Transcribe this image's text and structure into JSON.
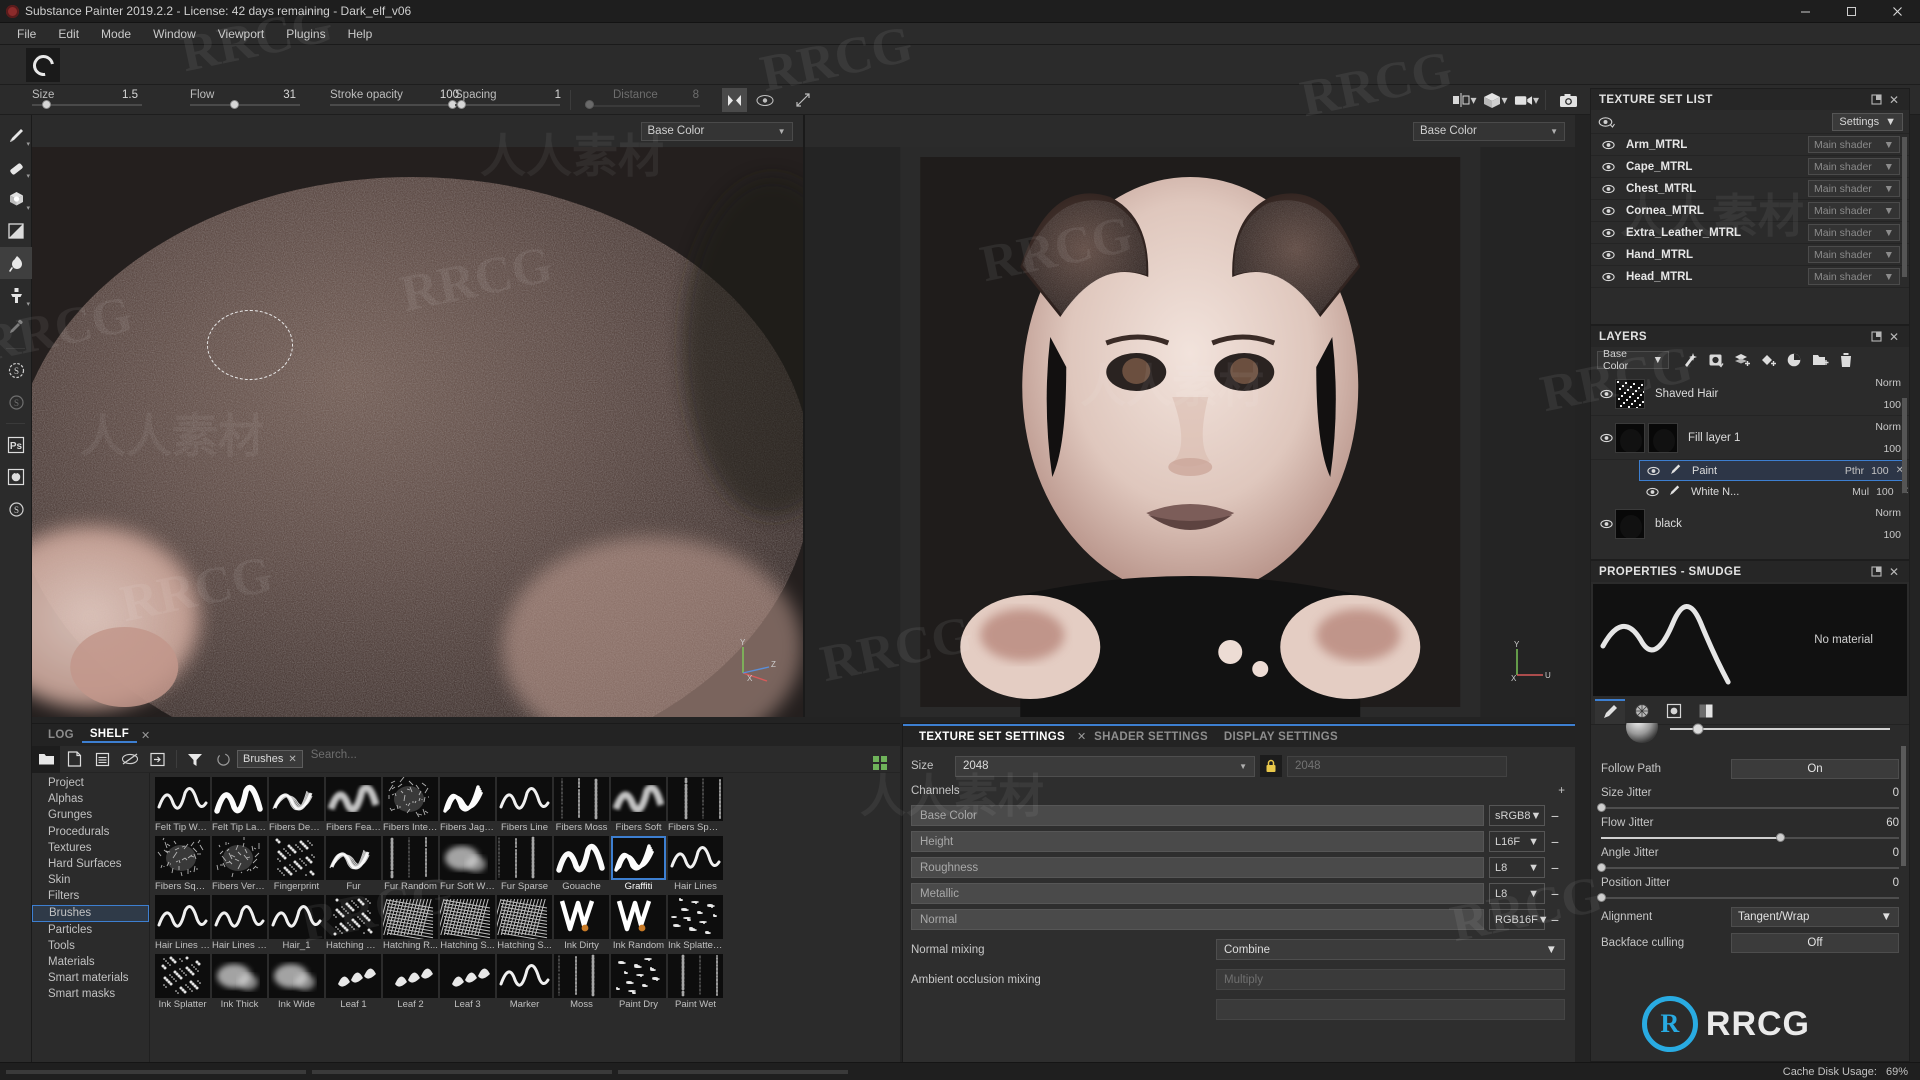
{
  "window": {
    "title": "Substance Painter 2019.2.2 - License: 42 days remaining - Dark_elf_v06",
    "minimize": "─",
    "maximize": "❐",
    "close": "✕"
  },
  "menubar": {
    "items": [
      "File",
      "Edit",
      "Mode",
      "Window",
      "Viewport",
      "Plugins",
      "Help"
    ]
  },
  "brush_params": [
    {
      "label": "Size",
      "value": "1.5",
      "dim": false
    },
    {
      "label": "Flow",
      "value": "31",
      "dim": false
    },
    {
      "label": "Stroke opacity",
      "value": "100",
      "dim": false
    },
    {
      "label": "Spacing",
      "value": "1",
      "dim": false
    },
    {
      "label": "Distance",
      "value": "8",
      "dim": true
    }
  ],
  "viewport": {
    "left_channel": "Base Color",
    "right_channel": "Base Color",
    "axis_labels": [
      "Y",
      "X",
      "Z",
      "Y",
      "X",
      "U"
    ]
  },
  "texture_set_list": {
    "title": "TEXTURE SET LIST",
    "settings_label": "Settings",
    "items": [
      {
        "name": "Arm_MTRL",
        "shader": "Main shader"
      },
      {
        "name": "Cape_MTRL",
        "shader": "Main shader"
      },
      {
        "name": "Chest_MTRL",
        "shader": "Main shader"
      },
      {
        "name": "Cornea_MTRL",
        "shader": "Main shader"
      },
      {
        "name": "Extra_Leather_MTRL",
        "shader": "Main shader"
      },
      {
        "name": "Hand_MTRL",
        "shader": "Main shader"
      },
      {
        "name": "Head_MTRL",
        "shader": "Main shader"
      }
    ]
  },
  "layers": {
    "title": "LAYERS",
    "channel_selector": "Base Color",
    "rows": [
      {
        "name": "Shaved Hair",
        "blend": "Norm",
        "opacity": "100"
      },
      {
        "name": "Fill layer 1",
        "blend": "Norm",
        "opacity": "100",
        "children": [
          {
            "name": "Paint",
            "mode": "Pthr",
            "opacity": "100",
            "selected": true
          },
          {
            "name": "White N...",
            "mode": "Mul",
            "opacity": "100",
            "selected": false
          }
        ]
      },
      {
        "name": "black",
        "blend": "Norm",
        "opacity": "100"
      }
    ]
  },
  "properties": {
    "title": "PROPERTIES - SMUDGE",
    "no_material": "No material",
    "controls": [
      {
        "type": "toggle",
        "label": "Follow Path",
        "value": "On"
      },
      {
        "type": "slider",
        "label": "Size Jitter",
        "value": "0",
        "pct": 0
      },
      {
        "type": "slider",
        "label": "Flow Jitter",
        "value": "60",
        "pct": 60
      },
      {
        "type": "slider",
        "label": "Angle Jitter",
        "value": "0",
        "pct": 0
      },
      {
        "type": "slider",
        "label": "Position Jitter",
        "value": "0",
        "pct": 0
      },
      {
        "type": "select",
        "label": "Alignment",
        "value": "Tangent/Wrap"
      },
      {
        "type": "toggle",
        "label": "Backface culling",
        "value": "Off"
      }
    ]
  },
  "shelf": {
    "tabs": [
      {
        "label": "LOG",
        "active": false
      },
      {
        "label": "SHELF",
        "active": true
      }
    ],
    "close": "✕",
    "filter_chip": "Brushes",
    "search_placeholder": "Search...",
    "categories": [
      {
        "label": "Project",
        "selected": false
      },
      {
        "label": "Alphas",
        "selected": false
      },
      {
        "label": "Grunges",
        "selected": false
      },
      {
        "label": "Procedurals",
        "selected": false
      },
      {
        "label": "Textures",
        "selected": false
      },
      {
        "label": "Hard Surfaces",
        "selected": false
      },
      {
        "label": "Skin",
        "selected": false
      },
      {
        "label": "Filters",
        "selected": false
      },
      {
        "label": "Brushes",
        "selected": true
      },
      {
        "label": "Particles",
        "selected": false
      },
      {
        "label": "Tools",
        "selected": false
      },
      {
        "label": "Materials",
        "selected": false
      },
      {
        "label": "Smart materials",
        "selected": false
      },
      {
        "label": "Smart masks",
        "selected": false
      }
    ],
    "brushes": [
      {
        "name": "Felt Tip Wat...",
        "kind": "wave-thin",
        "selected": false
      },
      {
        "name": "Felt Tip Large",
        "kind": "wave-thick",
        "selected": false
      },
      {
        "name": "Fibers Dense",
        "kind": "wave-fiber",
        "selected": false
      },
      {
        "name": "Fibers Feather",
        "kind": "wave-soft",
        "selected": false
      },
      {
        "name": "Fibers Interl...",
        "kind": "fiber-mess",
        "selected": false
      },
      {
        "name": "Fibers Jagged",
        "kind": "wave-jag",
        "selected": false
      },
      {
        "name": "Fibers Line",
        "kind": "wave-thin",
        "selected": false
      },
      {
        "name": "Fibers Moss",
        "kind": "noise",
        "selected": false
      },
      {
        "name": "Fibers Soft",
        "kind": "wave-soft",
        "selected": false
      },
      {
        "name": "Fibers Sparse",
        "kind": "noise",
        "selected": false
      },
      {
        "name": "Fibers Square",
        "kind": "fiber-mess",
        "selected": false
      },
      {
        "name": "Fibers Vertical",
        "kind": "fiber-mess",
        "selected": false
      },
      {
        "name": "Fingerprint",
        "kind": "dots",
        "selected": false
      },
      {
        "name": "Fur",
        "kind": "wave-fiber",
        "selected": false
      },
      {
        "name": "Fur Random",
        "kind": "noise",
        "selected": false
      },
      {
        "name": "Fur Soft Wide",
        "kind": "blob",
        "selected": false
      },
      {
        "name": "Fur Sparse",
        "kind": "noise",
        "selected": false
      },
      {
        "name": "Gouache",
        "kind": "wave-thick",
        "selected": false
      },
      {
        "name": "Graffiti",
        "kind": "wave-jag",
        "selected": true
      },
      {
        "name": "Hair Lines",
        "kind": "wave-thin",
        "selected": false
      },
      {
        "name": "Hair Lines D...",
        "kind": "wave-thin",
        "selected": false
      },
      {
        "name": "Hair Lines S...",
        "kind": "wave-thin",
        "selected": false
      },
      {
        "name": "Hair_1",
        "kind": "wave-thin",
        "selected": false
      },
      {
        "name": "Hatching G...",
        "kind": "dots",
        "selected": false
      },
      {
        "name": "Hatching R...",
        "kind": "hatch",
        "selected": false
      },
      {
        "name": "Hatching S...",
        "kind": "hatch",
        "selected": false
      },
      {
        "name": "Hatching S...",
        "kind": "hatch",
        "selected": false
      },
      {
        "name": "Ink Dirty",
        "kind": "ink",
        "selected": false
      },
      {
        "name": "Ink Random",
        "kind": "ink",
        "selected": false
      },
      {
        "name": "Ink Splatter ...",
        "kind": "splat",
        "selected": false
      },
      {
        "name": "Ink Splatter",
        "kind": "dots",
        "selected": false
      },
      {
        "name": "Ink Thick",
        "kind": "blob",
        "selected": false
      },
      {
        "name": "Ink Wide",
        "kind": "blob",
        "selected": false
      },
      {
        "name": "Leaf 1",
        "kind": "leaf",
        "selected": false
      },
      {
        "name": "Leaf 2",
        "kind": "leaf",
        "selected": false
      },
      {
        "name": "Leaf 3",
        "kind": "leaf",
        "selected": false
      },
      {
        "name": "Marker",
        "kind": "wave-thin",
        "selected": false
      },
      {
        "name": "Moss",
        "kind": "noise",
        "selected": false
      },
      {
        "name": "Paint Dry",
        "kind": "splat",
        "selected": false
      },
      {
        "name": "Paint Wet",
        "kind": "noise",
        "selected": false
      }
    ]
  },
  "texture_set_settings": {
    "tabs": [
      {
        "label": "TEXTURE SET SETTINGS",
        "active": true,
        "closable": true
      },
      {
        "label": "SHADER SETTINGS",
        "active": false,
        "closable": false
      },
      {
        "label": "DISPLAY SETTINGS",
        "active": false,
        "closable": false
      }
    ],
    "size_label": "Size",
    "size_value": "2048",
    "size_value_locked": "2048",
    "channels_label": "Channels",
    "add_symbol": "+",
    "channels": [
      {
        "name": "Base Color",
        "format": "sRGB8"
      },
      {
        "name": "Height",
        "format": "L16F"
      },
      {
        "name": "Roughness",
        "format": "L8"
      },
      {
        "name": "Metallic",
        "format": "L8"
      },
      {
        "name": "Normal",
        "format": "RGB16F"
      }
    ],
    "normal_mixing_label": "Normal mixing",
    "normal_mixing_value": "Combine",
    "ao_mixing_label": "Ambient occlusion mixing",
    "ao_mixing_value": "Multiply"
  },
  "statusbar": {
    "cache_label": "Cache Disk Usage:",
    "cache_value": "69%"
  },
  "watermarks": {
    "latin": "RRCG",
    "chinese": "人人素材",
    "logo_text": "RRCG",
    "logo_mark": "R"
  },
  "colors": {
    "accent": "#3d7fd1",
    "panel": "#2b2b2b",
    "dark": "#1f1f1f",
    "logo_blue": "#29abe2"
  }
}
